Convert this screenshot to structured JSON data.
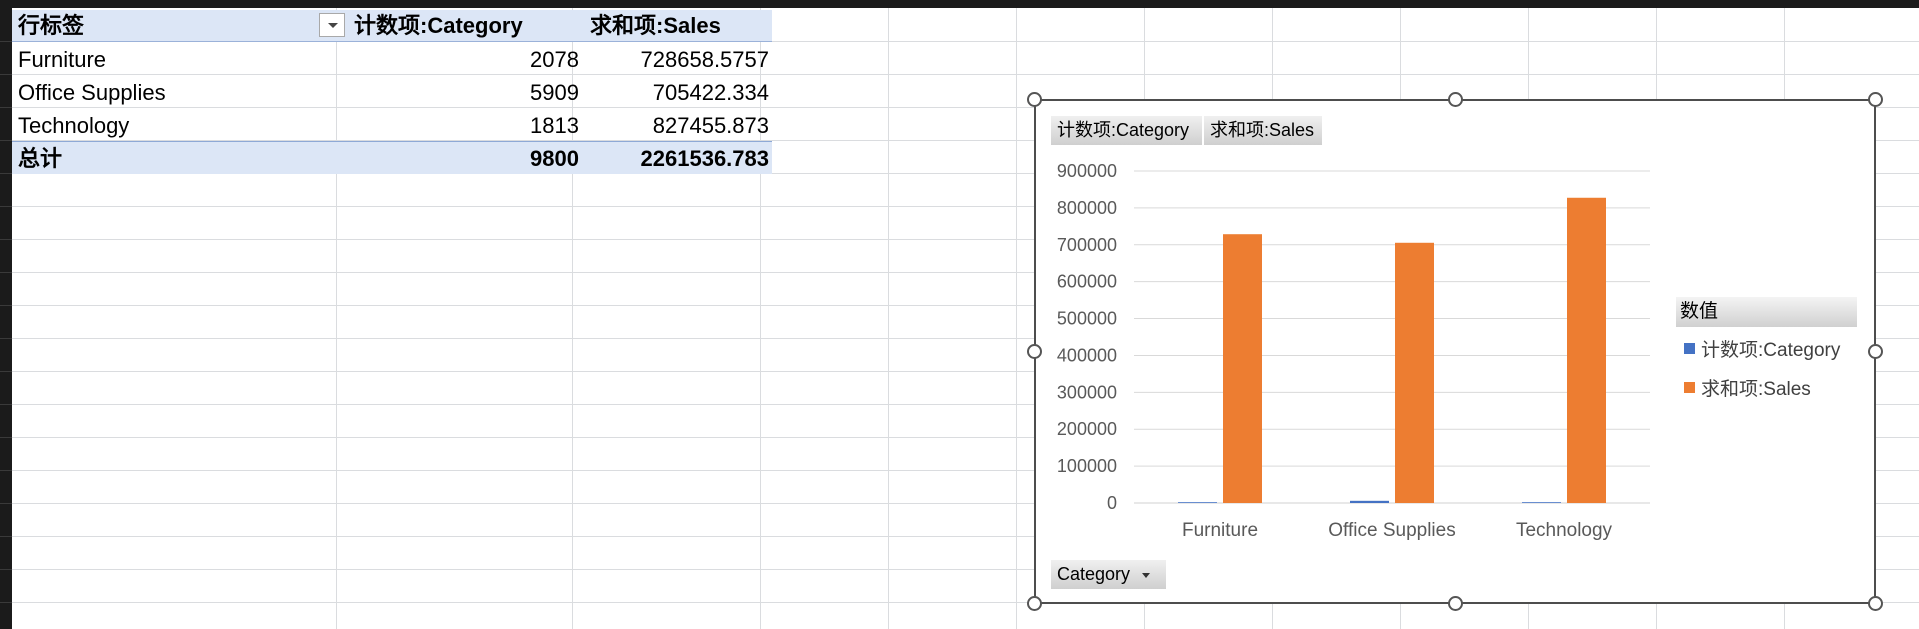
{
  "pivot": {
    "headers": [
      "行标签",
      "计数项:Category",
      "求和项:Sales"
    ],
    "rows": [
      {
        "label": "Furniture",
        "count": "2078",
        "sales": "728658.5757"
      },
      {
        "label": "Office Supplies",
        "count": "5909",
        "sales": "705422.334"
      },
      {
        "label": "Technology",
        "count": "1813",
        "sales": "827455.873"
      }
    ],
    "total": {
      "label": "总计",
      "count": "9800",
      "sales": "2261536.783"
    }
  },
  "chart_buttons": {
    "value_field_1": "计数项:Category",
    "value_field_2": "求和项:Sales",
    "axis_field": "Category"
  },
  "legend": {
    "title": "数值",
    "items": [
      {
        "name": "计数项:Category",
        "color": "#4472c4"
      },
      {
        "name": "求和项:Sales",
        "color": "#ed7d31"
      }
    ]
  },
  "chart_data": {
    "type": "bar",
    "categories": [
      "Furniture",
      "Office Supplies",
      "Technology"
    ],
    "series": [
      {
        "name": "计数项:Category",
        "values": [
          2078,
          5909,
          1813
        ],
        "color": "#4472c4"
      },
      {
        "name": "求和项:Sales",
        "values": [
          728658.5757,
          705422.334,
          827455.873
        ],
        "color": "#ed7d31"
      }
    ],
    "ylim": [
      0,
      900000
    ],
    "yticks": [
      "0",
      "100000",
      "200000",
      "300000",
      "400000",
      "500000",
      "600000",
      "700000",
      "800000",
      "900000"
    ],
    "grid": true,
    "legend": "right"
  }
}
